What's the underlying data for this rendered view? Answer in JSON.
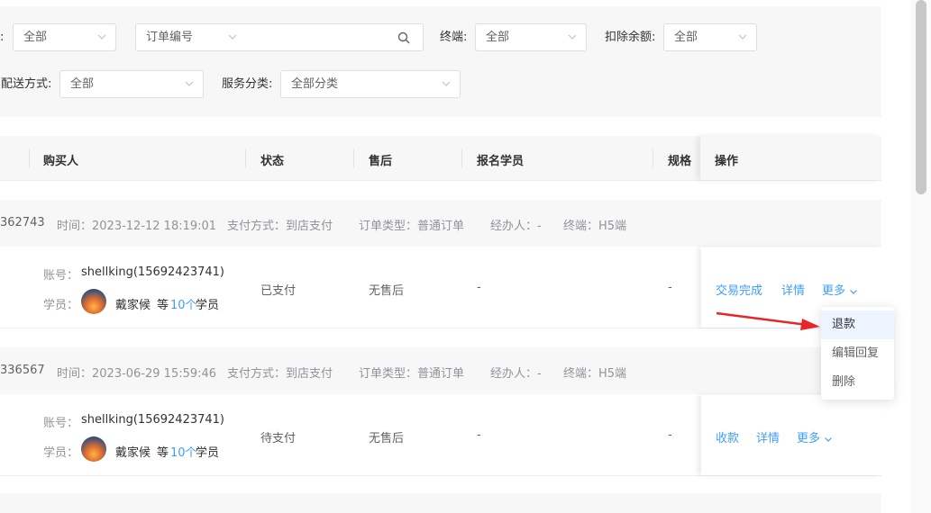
{
  "filters": {
    "first_select_value": "全部",
    "order_type_select": "订单编号",
    "order_search_value": "",
    "terminal_label": "终端:",
    "terminal_value": "全部",
    "deduct_label": "扣除余额:",
    "deduct_value": "全部",
    "delivery_label": "配送方式:",
    "delivery_value": "全部",
    "service_label": "服务分类:",
    "service_value": "全部分类"
  },
  "table": {
    "columns": {
      "buyer": "购买人",
      "status": "状态",
      "after_sale": "售后",
      "students": "报名学员",
      "spec": "规格",
      "actions": "操作"
    }
  },
  "orders": [
    {
      "order_no": "362743",
      "time": "时间：2023-12-12 18:19:01",
      "payment": "支付方式：到店支付",
      "order_type": "订单类型：普通订单",
      "handler": "经办人：-",
      "terminal": "终端：H5端",
      "account_label": "账号：",
      "account": "shellking(15692423741)",
      "student_label": "学员：",
      "student_name": "戴家候",
      "student_more_prefix": "等",
      "student_more_count": "10个",
      "student_more_suffix": "学员",
      "status": "已支付",
      "after_sale": "无售后",
      "enrolled": "-",
      "spec": "-",
      "action_primary": "交易完成",
      "action_detail": "详情",
      "action_more": "更多"
    },
    {
      "order_no": "336567",
      "time": "时间：2023-06-29 15:59:46",
      "payment": "支付方式：到店支付",
      "order_type": "订单类型：普通订单",
      "handler": "经办人：-",
      "terminal": "终端：H5端",
      "account_label": "账号：",
      "account": "shellking(15692423741)",
      "student_label": "学员：",
      "student_name": "戴家候",
      "student_more_prefix": "等",
      "student_more_count": "10个",
      "student_more_suffix": "学员",
      "status": "待支付",
      "after_sale": "无售后",
      "enrolled": "-",
      "spec": "-",
      "action_primary": "收款",
      "action_detail": "详情",
      "action_more": "更多"
    }
  ],
  "more_menu": {
    "items": [
      "退款",
      "编辑回复",
      "删除"
    ],
    "highlighted": "退款"
  },
  "colors": {
    "link": "#409eff",
    "annotation_arrow": "#e8262a"
  }
}
